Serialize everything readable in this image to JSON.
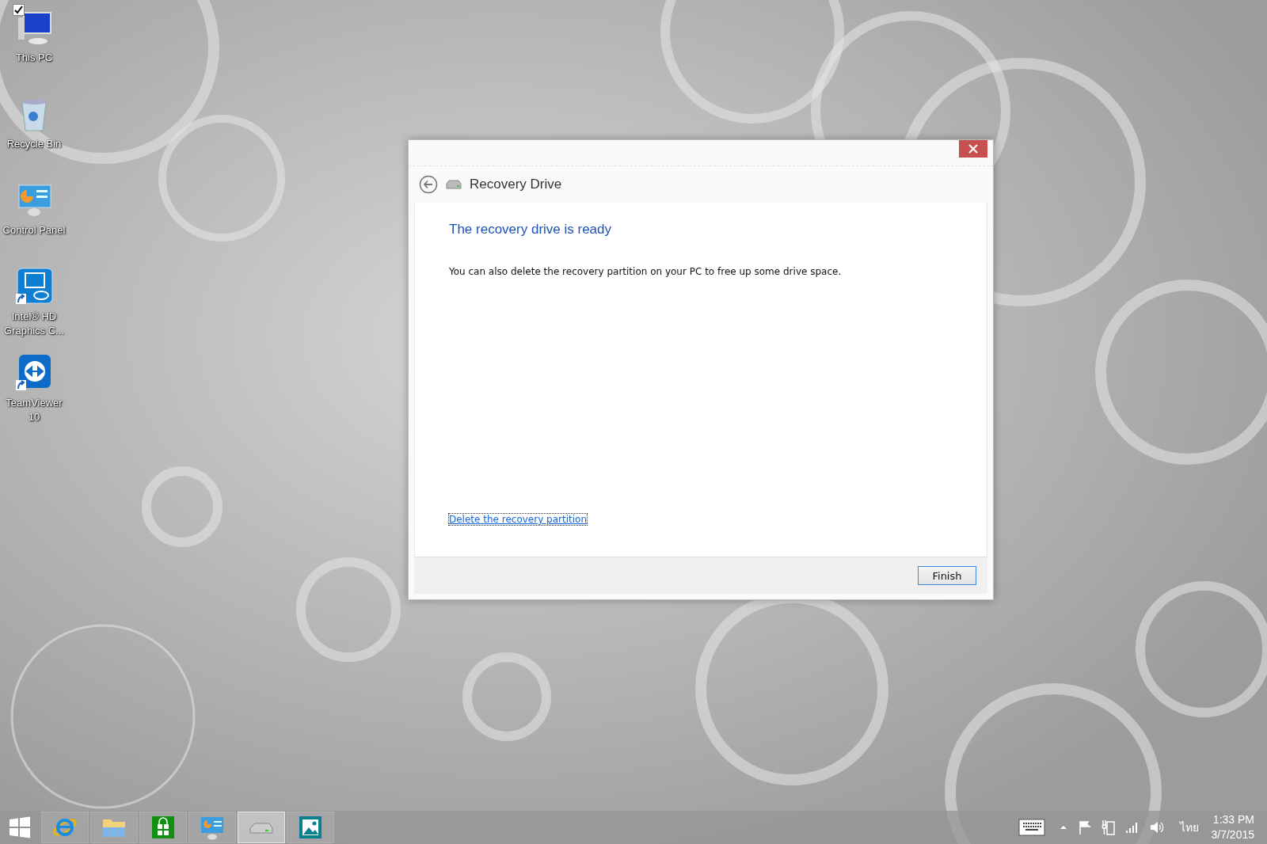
{
  "desktop_icons": [
    {
      "kind": "computer",
      "label": "This PC",
      "selected": true,
      "shortcut": false
    },
    {
      "kind": "recycle-bin",
      "label": "Recycle Bin",
      "selected": false,
      "shortcut": false
    },
    {
      "kind": "control-panel",
      "label": "Control Panel",
      "selected": false,
      "shortcut": false
    },
    {
      "kind": "graphics",
      "label": "Intel® HD Graphics C...",
      "selected": false,
      "shortcut": true
    },
    {
      "kind": "remote",
      "label": "TeamViewer 10",
      "selected": false,
      "shortcut": true
    }
  ],
  "window": {
    "title": "Recovery Drive",
    "heading": "The recovery drive is ready",
    "body": "You can also delete the recovery partition on your PC to free up some drive space.",
    "link": "Delete the recovery partition",
    "buttons": [
      "Finish"
    ]
  },
  "taskbar": {
    "apps": [
      {
        "kind": "start",
        "active": false
      },
      {
        "kind": "browser",
        "active": false
      },
      {
        "kind": "folder",
        "active": false
      },
      {
        "kind": "store",
        "active": false
      },
      {
        "kind": "control-panel",
        "active": false
      },
      {
        "kind": "drive",
        "active": true
      },
      {
        "kind": "photos",
        "active": false
      }
    ],
    "language": "ไทย",
    "time": "1:33 PM",
    "date": "3/7/2015"
  }
}
